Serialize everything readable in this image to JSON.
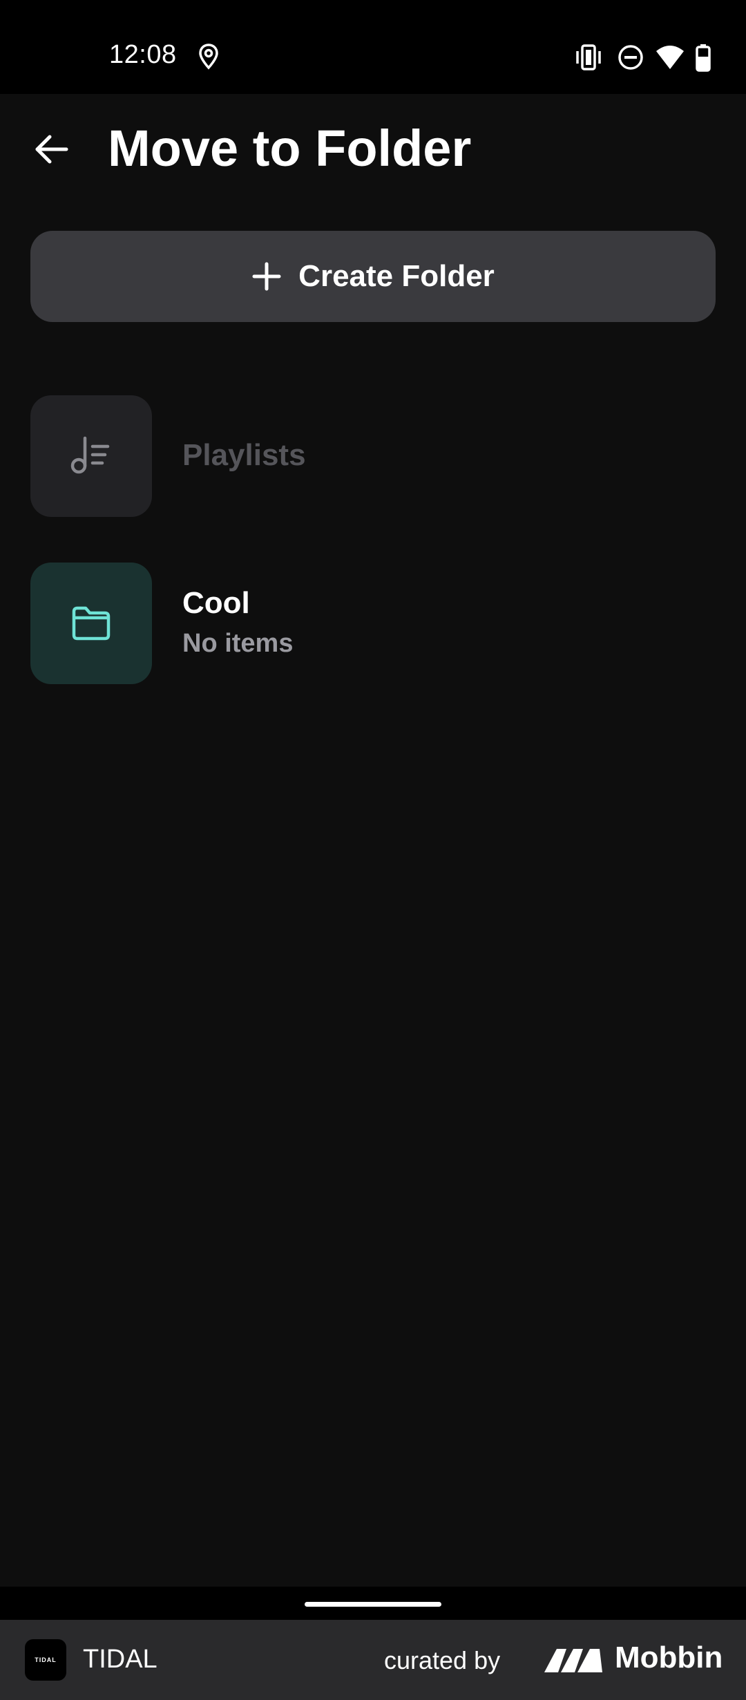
{
  "status_bar": {
    "time": "12:08",
    "icons": [
      "location-icon",
      "vibrate-icon",
      "do-not-disturb-icon",
      "wifi-icon",
      "battery-icon"
    ]
  },
  "header": {
    "back_icon": "arrow-left-icon",
    "title": "Move to Folder"
  },
  "create_button": {
    "icon": "plus-icon",
    "label": "Create Folder"
  },
  "folders": [
    {
      "title": "Playlists",
      "icon": "music-list-icon",
      "state": "disabled"
    },
    {
      "title": "Cool",
      "subtitle": "No items",
      "icon": "folder-icon",
      "accent": "#6fe3d6"
    }
  ],
  "footer": {
    "app_name": "TIDAL",
    "app_icon_text": "TIDAL",
    "curated_by": "curated by",
    "brand": "Mobbin"
  },
  "colors": {
    "background": "#0e0e0e",
    "button_bg": "#3a3a3e",
    "folder_tile_bg": "#1a3230",
    "accent": "#6fe3d6"
  }
}
